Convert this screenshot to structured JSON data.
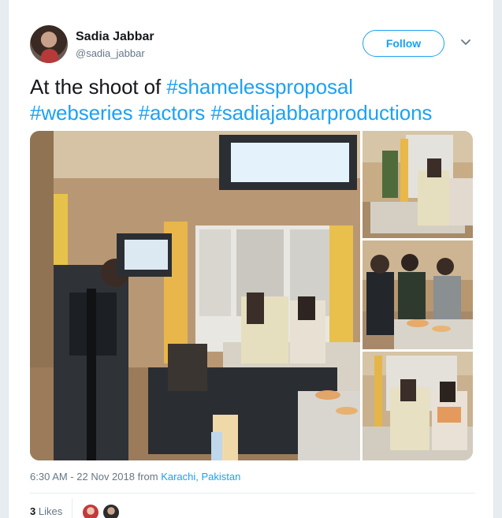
{
  "author": {
    "name": "Sadia Jabbar",
    "handle": "@sadia_jabbar"
  },
  "follow_label": "Follow",
  "tweet": {
    "prefix": "At the shoot of ",
    "hashtags": [
      "#shamelessproposal",
      "#webseries",
      "#actors",
      "#sadiajabbarproductions"
    ]
  },
  "meta": {
    "timestamp": "6:30 AM - 22 Nov 2018 from ",
    "location": "Karachi, Pakistan"
  },
  "engagement": {
    "likes_count": "3",
    "likes_label": "Likes"
  },
  "icons": {
    "more": "chevron-down-icon"
  },
  "colors": {
    "accent": "#1da1f2",
    "text": "#14171a",
    "muted": "#657786"
  }
}
